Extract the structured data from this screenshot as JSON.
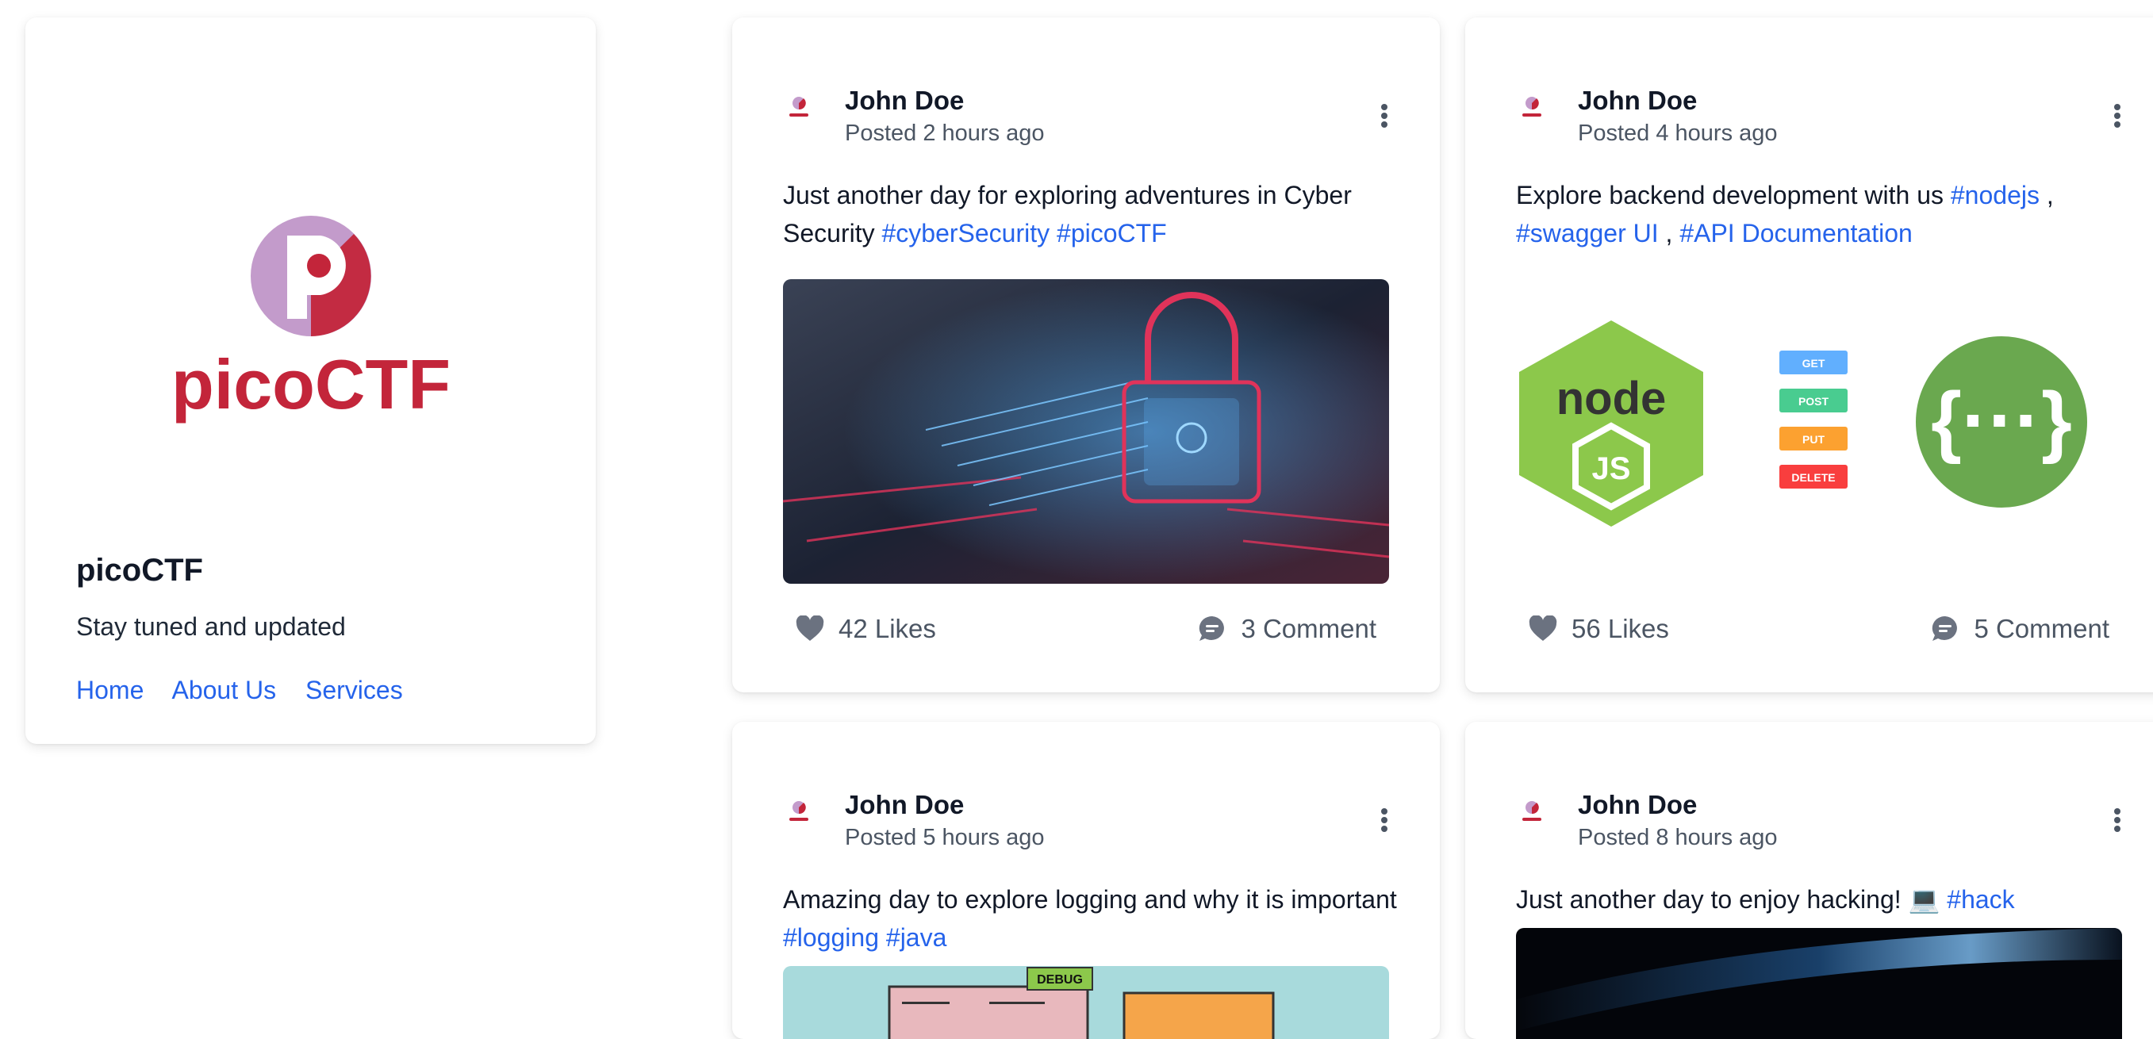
{
  "profile": {
    "logo_text": "picoCTF",
    "title": "picoCTF",
    "tagline": "Stay tuned and updated",
    "links": [
      "Home",
      "About Us",
      "Services"
    ]
  },
  "posts": [
    {
      "author": "John Doe",
      "time": "Posted 2 hours ago",
      "text_pre": "Just another day for exploring adventures in Cyber Security ",
      "tags": [
        "#cyberSecurity",
        "#picoCTF"
      ],
      "likes": "42 Likes",
      "comments": "3 Comment"
    },
    {
      "author": "John Doe",
      "time": "Posted 4 hours ago",
      "text_pre": "Explore backend development with us ",
      "tags": [
        "#nodejs",
        "#swagger UI",
        "#API Documentation"
      ],
      "likes": "56 Likes",
      "comments": "5 Comment",
      "image_labels": [
        "GET",
        "POST",
        "PUT",
        "DELETE"
      ]
    },
    {
      "author": "John Doe",
      "time": "Posted 5 hours ago",
      "text_pre": "Amazing day to explore logging and why it is important ",
      "tags": [
        "#logging",
        "#java"
      ],
      "image_label": "DEBUG"
    },
    {
      "author": "John Doe",
      "time": "Posted 8 hours ago",
      "text_pre": "Just another day to enjoy hacking! 💻 ",
      "tags": [
        "#hack"
      ]
    }
  ],
  "colors": {
    "link": "#2563eb",
    "brand_red": "#c3253a",
    "brand_purple": "#c39bcb",
    "node_green": "#8cc84b",
    "swagger_green": "#6aa84f"
  }
}
